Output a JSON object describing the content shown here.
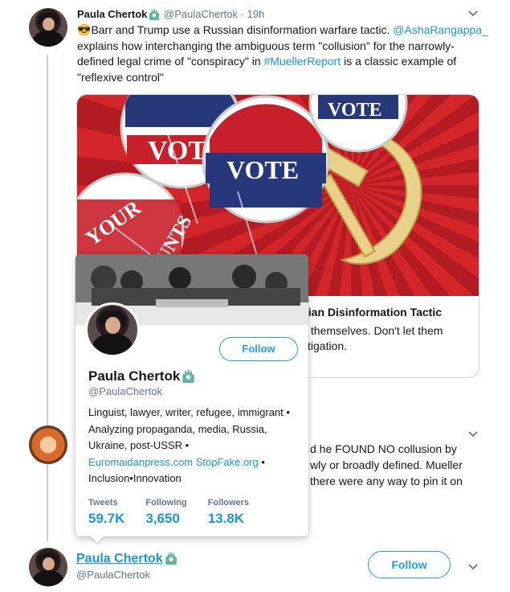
{
  "tweet": {
    "author_name": "Paula Chertok",
    "author_handle": "@PaulaChertok",
    "separator": "·",
    "time": "19h",
    "emoji": "😎",
    "text_1": "Barr and Trump use a Russian disinformation warfare tactic. ",
    "mention": "@AshaRangappa_",
    "text_2": " explains how interchanging the ambiguous term \"collusion\" for the narrowly-defined legal crime of \"conspiracy\" in ",
    "hashtag": "#MuellerReport",
    "text_3": " is a classic example of \"reflexive control\""
  },
  "card": {
    "image_words": [
      "VOTE",
      "VOTE",
      "VOTE",
      "YOUR",
      "COUNTS"
    ],
    "title_partial": "sian Disinformation Tactic",
    "desc_partial": "it themselves. Don't let them stigation."
  },
  "hover_card": {
    "follow_label": "Follow",
    "name": "Paula Chertok",
    "handle": "@PaulaChertok",
    "bio_text": "Linguist, lawyer, writer, refugee, immigrant • Analyzing propaganda, media, Russia, Ukraine, post-USSR •",
    "bio_link_1": "Euromaidanpress.com",
    "bio_link_2": "StopFake.org",
    "bio_tail": " • Inclusion•Innovation",
    "stats": {
      "tweets_label": "Tweets",
      "tweets_value": "59.7K",
      "following_label": "Following",
      "following_value": "3,650",
      "followers_label": "Followers",
      "followers_value": "13.8K"
    }
  },
  "reply": {
    "text_line_1": "d he FOUND NO collusion by",
    "text_line_2": "wly or broadly defined.  Mueller",
    "text_line_3": "there were any way to pin it on"
  },
  "bottom_profile": {
    "name": "Paula Chertok",
    "handle": "@PaulaChertok",
    "follow_label": "Follow"
  },
  "icons": {
    "caret": "chevron-down-icon",
    "badge": "statue-of-liberty-icon"
  },
  "colors": {
    "link": "#1b95e0",
    "accent": "#1da1f2",
    "muted": "#657786",
    "thread_line": "#c4cfd6"
  }
}
